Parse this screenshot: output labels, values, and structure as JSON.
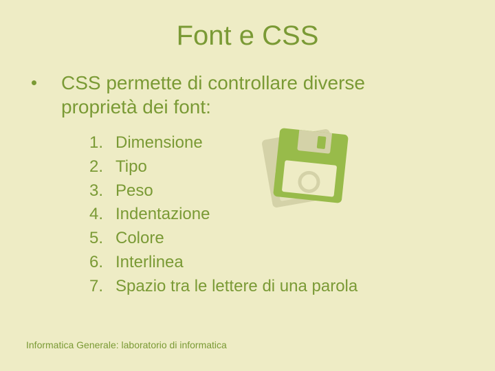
{
  "title": "Font e CSS",
  "lead": "CSS permette di controllare diverse proprietà dei font:",
  "items": [
    "Dimensione",
    "Tipo",
    "Peso",
    "Indentazione",
    "Colore",
    "Interlinea",
    "Spazio tra le lettere di una parola"
  ],
  "footer": "Informatica Generale: laboratorio di informatica"
}
